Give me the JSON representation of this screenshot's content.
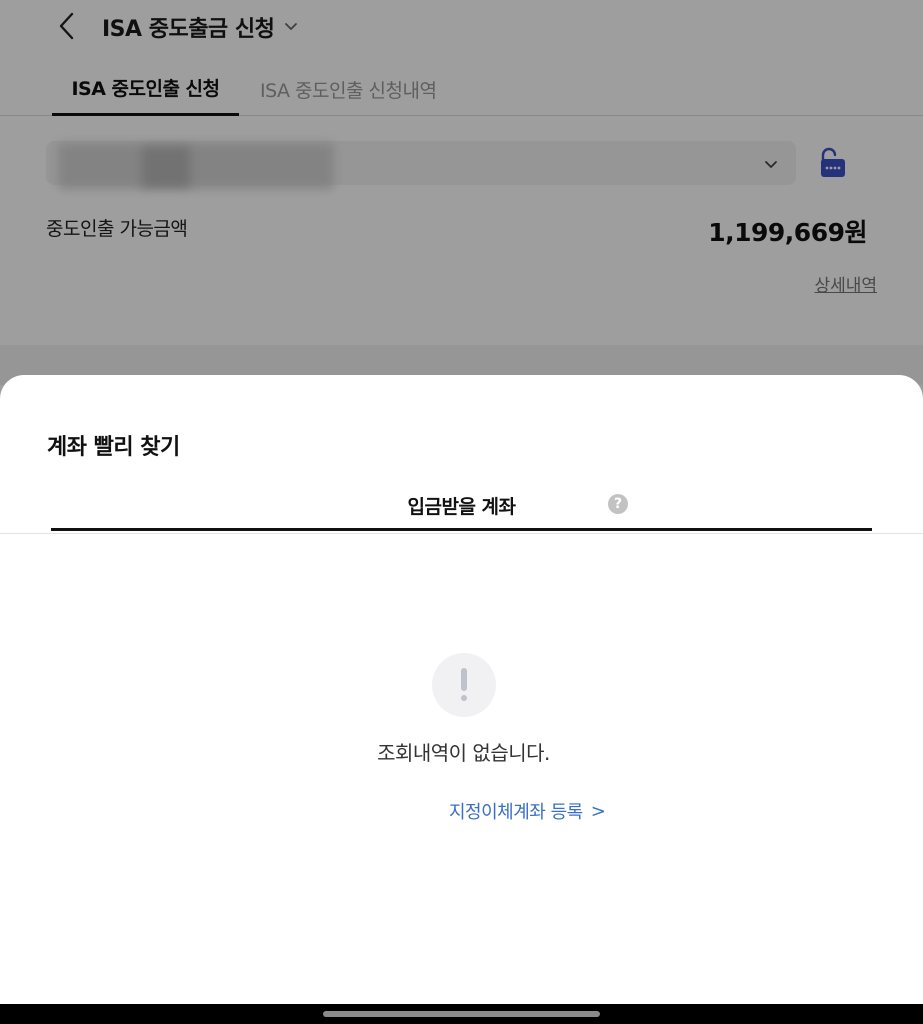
{
  "header": {
    "title": "ISA 중도출금 신청",
    "icons": {
      "back": "chevron-left-icon",
      "title_dropdown": "chevron-down-icon"
    }
  },
  "tabs": [
    {
      "label": "ISA 중도인출 신청",
      "active": true
    },
    {
      "label": "ISA 중도인출 신청내역",
      "active": false
    }
  ],
  "account_select": {
    "value": "",
    "icons": {
      "dropdown": "chevron-down-icon",
      "lock": "keypad-lock-icon"
    },
    "lock_color": "#3a4fc7"
  },
  "available": {
    "label": "중도인출 가능금액",
    "amount": "1,199,669원",
    "detail_link": "상세내역"
  },
  "sheet": {
    "title": "계좌 빨리 찾기",
    "tab_label": "입금받을 계좌",
    "help_icon": "?",
    "empty_icon": "exclamation-icon",
    "empty_message": "조회내역이 없습니다.",
    "register_link": "지정이체계좌 등록",
    "register_chevron": ">",
    "link_color": "#3a6fc4"
  }
}
